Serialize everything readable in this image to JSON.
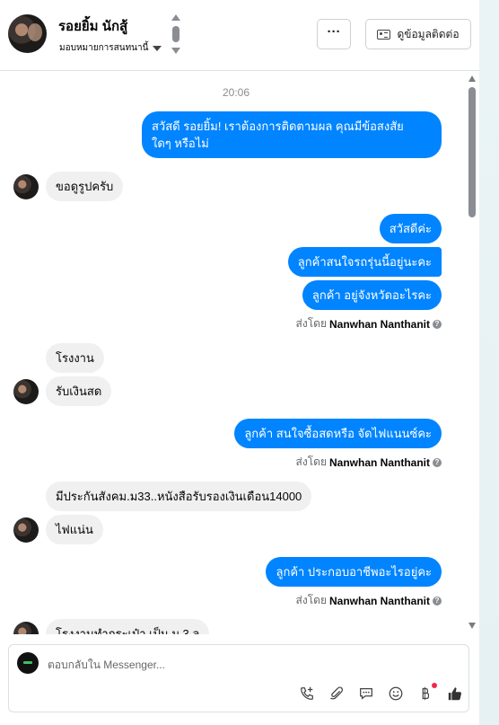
{
  "header": {
    "name": "รอยยิ้ม นักสู้",
    "assign_label": "มอบหมายการสนทนานี้",
    "more_label": "···",
    "contact_label": "ดูข้อมูลติดต่อ"
  },
  "thread": {
    "timestamp": "20:06",
    "sent_by_prefix": "ส่งโดย",
    "sender_name": "Nanwhan Nanthanit",
    "messages": [
      {
        "dir": "out",
        "lines": [
          "สวัสดี รอยยิ้ม! เราต้องการติดตามผล คุณมีข้อสงสัย",
          "ใดๆ หรือไม่"
        ]
      },
      {
        "dir": "in",
        "text": "ขอดูรูปครับ"
      },
      {
        "dir": "out",
        "text": "สวัสดีค่ะ"
      },
      {
        "dir": "out",
        "text": "ลูกค้าสนใจรถรุ่นนี้อยู่นะคะ"
      },
      {
        "dir": "out",
        "text": "ลูกค้า อยู่จังหวัดอะไรคะ"
      },
      {
        "dir": "in",
        "text": "โรงงาน"
      },
      {
        "dir": "in",
        "text": "รับเงินสด"
      },
      {
        "dir": "out",
        "text": "ลูกค้า สนใจซื้อสดหรือ จัดไฟแนนซ์คะ"
      },
      {
        "dir": "in",
        "text": "มีประกันสังคม.ม33..หนังสือรับรองเงินเดือน14000"
      },
      {
        "dir": "in",
        "text": "ไฟแน่น"
      },
      {
        "dir": "out",
        "text": "ลูกค้า ประกอบอาชีพอะไรอยู่คะ"
      },
      {
        "dir": "in",
        "text": "โรงงานทำกระเป๋า เป็น ม.3.ล"
      }
    ]
  },
  "composer": {
    "placeholder": "ตอบกลับใน Messenger..."
  },
  "icons": [
    "call-add-icon",
    "attach-icon",
    "saved-reply-icon",
    "emoji-icon",
    "payment-icon",
    "thumbs-up-icon"
  ],
  "colors": {
    "accent": "#0084ff",
    "incoming": "#f0f0f0",
    "notification": "#f02849"
  }
}
